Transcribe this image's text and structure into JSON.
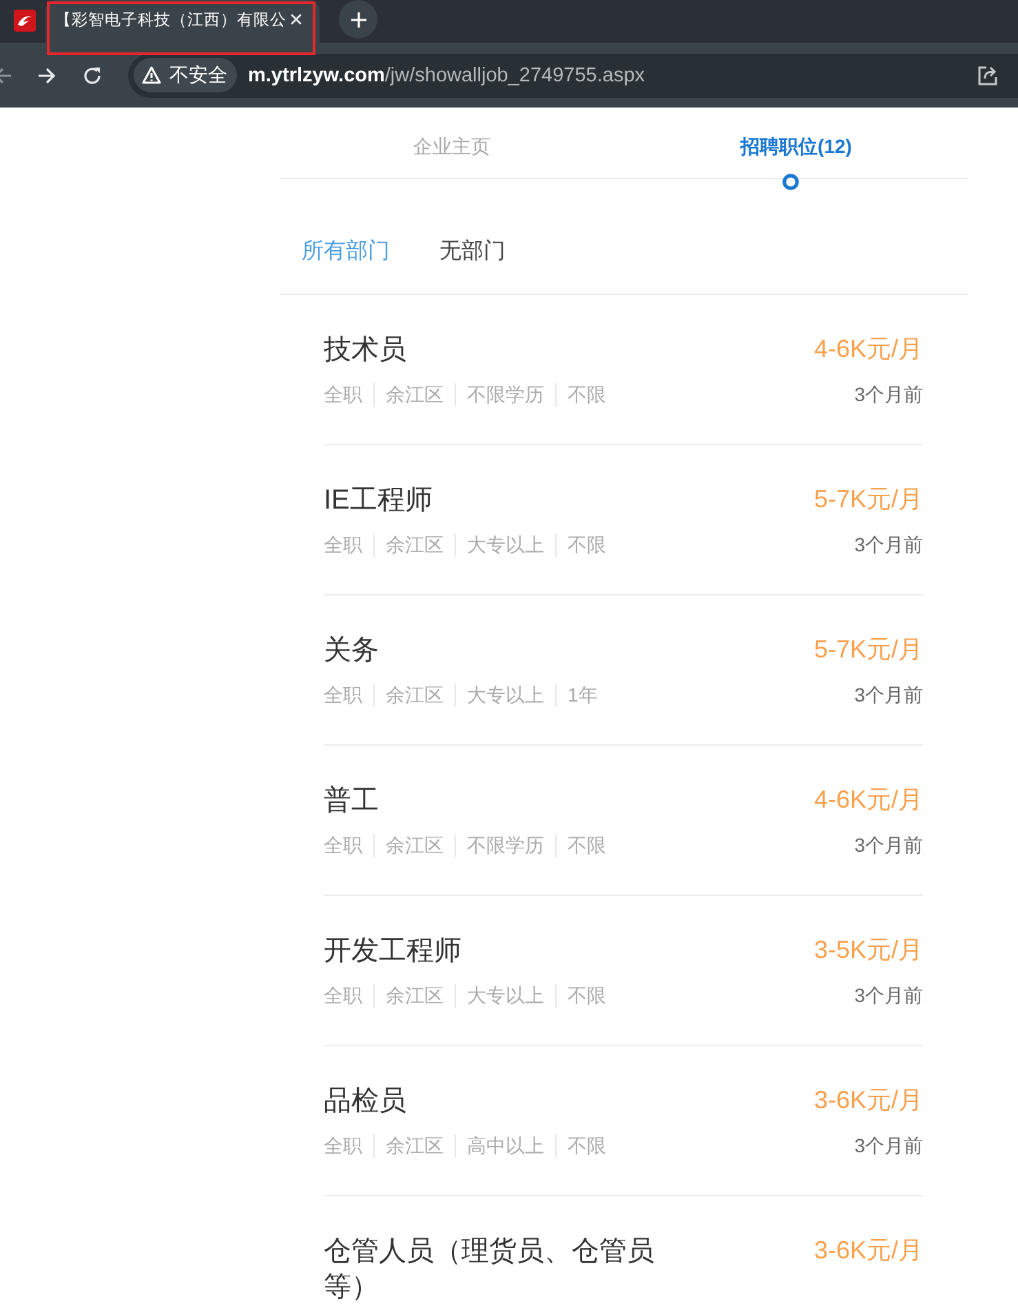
{
  "browser": {
    "tabs": [
      {
        "title": "【彩智电子科技（江西）有限公",
        "selected": true,
        "highlighted": true
      }
    ],
    "address_bar": {
      "security_label": "不安全",
      "url_host": "m.ytrlzyw.com",
      "url_path": "/jw/showalljob_2749755.aspx"
    }
  },
  "tabs": [
    {
      "label": "企业主页",
      "selected": false
    },
    {
      "label": "招聘职位(12)",
      "selected": true
    }
  ],
  "departments": [
    {
      "label": "所有部门",
      "selected": true
    },
    {
      "label": "无部门",
      "selected": false
    }
  ],
  "jobs": [
    {
      "title": "技术员",
      "salary": "4-6K元/月",
      "tags": [
        "全职",
        "余江区",
        "不限学历",
        "不限"
      ],
      "posted": "3个月前"
    },
    {
      "title": "IE工程师",
      "salary": "5-7K元/月",
      "tags": [
        "全职",
        "余江区",
        "大专以上",
        "不限"
      ],
      "posted": "3个月前"
    },
    {
      "title": "关务",
      "salary": "5-7K元/月",
      "tags": [
        "全职",
        "余江区",
        "大专以上",
        "1年"
      ],
      "posted": "3个月前"
    },
    {
      "title": "普工",
      "salary": "4-6K元/月",
      "tags": [
        "全职",
        "余江区",
        "不限学历",
        "不限"
      ],
      "posted": "3个月前"
    },
    {
      "title": "开发工程师",
      "salary": "3-5K元/月",
      "tags": [
        "全职",
        "余江区",
        "大专以上",
        "不限"
      ],
      "posted": "3个月前"
    },
    {
      "title": "品检员",
      "salary": "3-6K元/月",
      "tags": [
        "全职",
        "余江区",
        "高中以上",
        "不限"
      ],
      "posted": "3个月前"
    },
    {
      "title": "仓管人员（理货员、仓管员等）",
      "salary": "3-6K元/月"
    }
  ]
}
